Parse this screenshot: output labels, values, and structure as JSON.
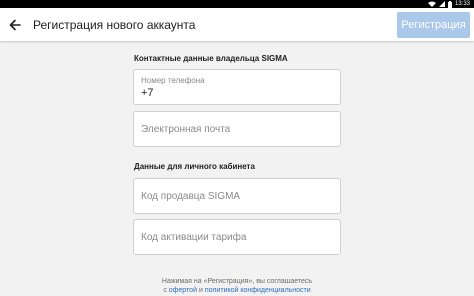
{
  "status_bar": {
    "time": "13:33"
  },
  "app_bar": {
    "back_icon": "arrow-left-icon",
    "title": "Регистрация нового аккаунта",
    "register_button": "Регистрация"
  },
  "contact_section": {
    "title": "Контактные данные владельца SIGMA",
    "phone": {
      "label": "Номер телефона",
      "value": "+7"
    },
    "email": {
      "placeholder": "Электронная почта"
    }
  },
  "cabinet_section": {
    "title": "Данные для личного кабинета",
    "seller_code": {
      "placeholder": "Код продавца SIGMA"
    },
    "activation_code": {
      "placeholder": "Код активации тарифа"
    }
  },
  "consent": {
    "line1": "Нажимая на «Регистрация», вы соглашаетесь",
    "prefix": "с",
    "offer_link": "офертой",
    "and": "и",
    "privacy_link": "политикой конфиденциальности"
  },
  "colors": {
    "accent_disabled": "#a9c8ea",
    "link": "#2f6fc1",
    "background": "#f2f2f2"
  }
}
